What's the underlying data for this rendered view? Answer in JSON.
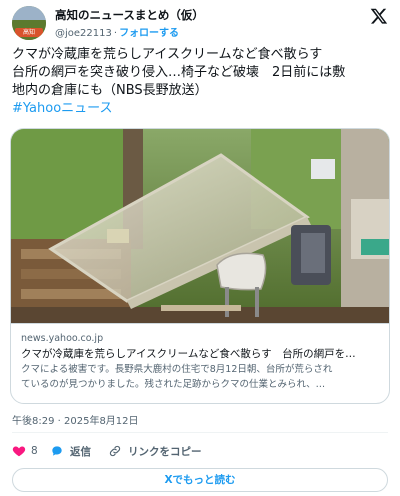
{
  "account": {
    "name": "高知のニュースまとめ（仮）",
    "handle": "@joe22113",
    "separator": "·",
    "follow_label": "フォローする",
    "avatar_badge": "高知"
  },
  "tweet": {
    "lines": [
      "クマが冷蔵庫を荒らしアイスクリームなど食べ散らす",
      "台所の網戸を突き破り侵入…椅子など破壊　2日前には敷",
      "地内の倉庫にも（NBS長野放送）"
    ],
    "hashtag": "#Yahooニュース"
  },
  "card": {
    "domain": "news.yahoo.co.jp",
    "title": "クマが冷蔵庫を荒らしアイスクリームなど食べ散らす　台所の網戸を…",
    "description_lines": [
      "クマによる被害です。長野県大鹿村の住宅で8月12日朝、台所が荒らされ",
      "ているのが見つかりました。残された足跡からクマの仕業とみられ、…"
    ]
  },
  "timestamp": "午後8:29 · 2025年8月12日",
  "actions": {
    "like_count": "8",
    "reply_label": "返信",
    "copy_link_label": "リンクをコピー"
  },
  "read_more_label": "Xでもっと読む",
  "colors": {
    "accent": "#1d9bf0",
    "like": "#f91880",
    "secondary_text": "#536471",
    "border": "#cfd9de"
  },
  "icons": [
    "x-logo-icon",
    "heart-icon",
    "reply-bubble-icon",
    "link-icon"
  ]
}
